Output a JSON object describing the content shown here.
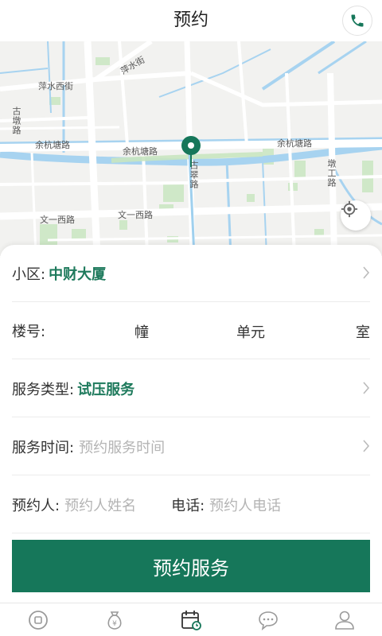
{
  "header": {
    "title": "预约",
    "phone_icon": "phone-icon"
  },
  "map": {
    "labels": {
      "pingshui_street": "萍水街",
      "pingshui_west_street": "萍水西街",
      "gudun_road": "古墩路",
      "yuhangtang_road_1": "余杭塘路",
      "yuhangtang_road_2": "余杭塘路",
      "yuhangtang_road_3": "余杭塘路",
      "gucui_road": "古翠路",
      "dungong_road": "墩工路",
      "wenyi_west_road_1": "文一西路",
      "wenyi_west_road_2": "文一西路"
    },
    "pin_icon": "location-pin-icon",
    "locate_icon": "locate-icon",
    "accent_color": "#16775a"
  },
  "form": {
    "community": {
      "label": "小区:",
      "value": "中财大厦"
    },
    "building": {
      "label": "楼号:",
      "unit_building": "幢",
      "unit_unit": "单元",
      "unit_room": "室"
    },
    "service_type": {
      "label": "服务类型:",
      "value": "试压服务"
    },
    "service_time": {
      "label": "服务时间:",
      "placeholder": "预约服务时间"
    },
    "person": {
      "label": "预约人:",
      "placeholder": "预约人姓名"
    },
    "phone": {
      "label": "电话:",
      "placeholder": "预约人电话"
    },
    "submit_label": "预约服务"
  },
  "tabbar": {
    "tabs": [
      {
        "icon": "home-icon",
        "active": false
      },
      {
        "icon": "money-bag-icon",
        "active": false
      },
      {
        "icon": "calendar-icon",
        "active": true
      },
      {
        "icon": "chat-icon",
        "active": false
      },
      {
        "icon": "user-icon",
        "active": false
      }
    ]
  }
}
